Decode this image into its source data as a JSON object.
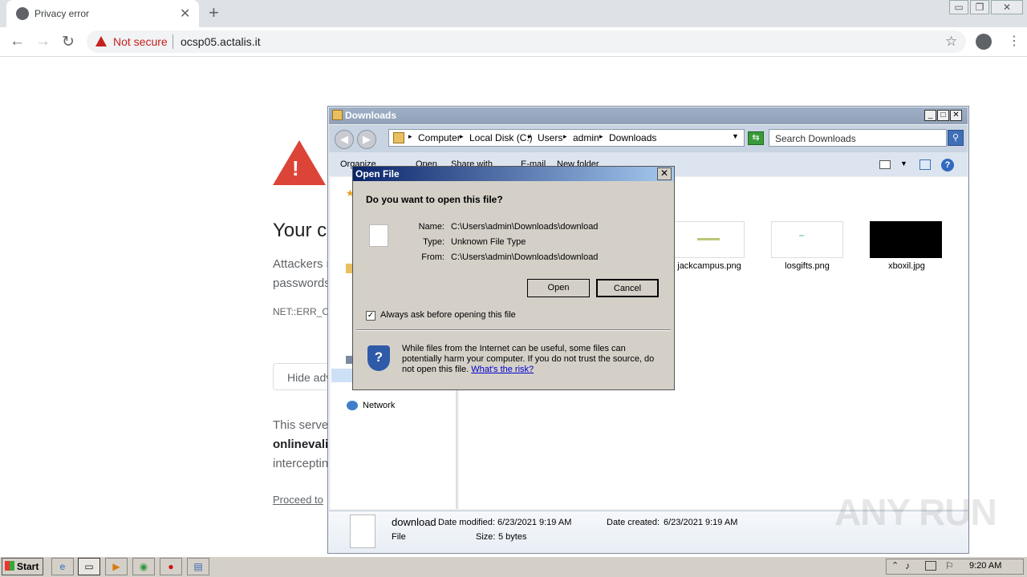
{
  "browser": {
    "tab_title": "Privacy error",
    "not_secure_label": "Not secure",
    "url": "ocsp05.actalis.it"
  },
  "page": {
    "title": "Your c",
    "p1_line1": "Attackers r",
    "p1_line2": "passwords",
    "error_code": "NET::ERR_C",
    "hide_button": "Hide adv",
    "p2_line1": "This server",
    "p2_line2": "onlinevali",
    "p2_line3": "interceptin",
    "proceed_link": "Proceed to"
  },
  "explorer": {
    "title": "Downloads",
    "breadcrumbs": [
      "Computer",
      "Local Disk (C:)",
      "Users",
      "admin",
      "Downloads"
    ],
    "search_placeholder": "Search Downloads",
    "command_bar": [
      "Organize",
      "Open",
      "Share with",
      "E-mail",
      "New folder"
    ],
    "nav_network": "Network",
    "files": [
      {
        "name": "jackcampus.png"
      },
      {
        "name": "losgifts.png"
      },
      {
        "name": "xboxil.jpg"
      }
    ],
    "details": {
      "name": "download",
      "type": "File",
      "modified_label": "Date modified:",
      "modified_value": "6/23/2021 9:19 AM",
      "created_label": "Date created:",
      "created_value": "6/23/2021 9:19 AM",
      "size_label": "Size:",
      "size_value": "5 bytes"
    }
  },
  "dialog": {
    "title": "Open File",
    "question": "Do you want to open this file?",
    "name_label": "Name:",
    "name_value": "C:\\Users\\admin\\Downloads\\download",
    "type_label": "Type:",
    "type_value": "Unknown File Type",
    "from_label": "From:",
    "from_value": "C:\\Users\\admin\\Downloads\\download",
    "open_button": "Open",
    "cancel_button": "Cancel",
    "checkbox_label": "Always ask before opening this file",
    "checkbox_checked": true,
    "info_text": "While files from the Internet can be useful, some files can potentially harm your computer. If you do not trust the source, do not open this file.",
    "risk_link": "What's the risk?"
  },
  "taskbar": {
    "start_label": "Start",
    "clock": "9:20 AM"
  },
  "watermark": "ANY RUN"
}
